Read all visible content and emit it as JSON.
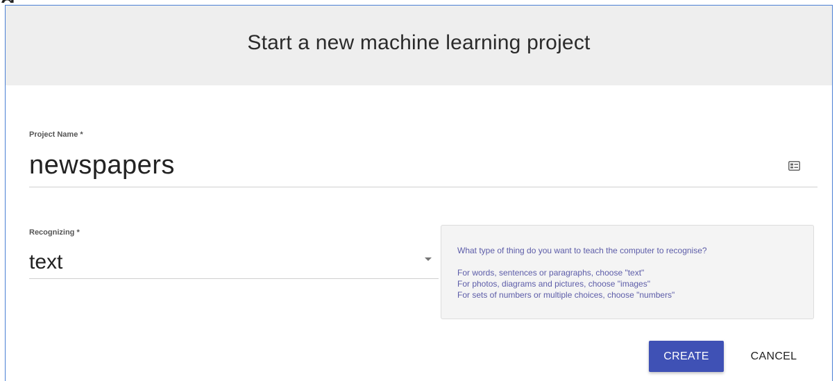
{
  "dialog": {
    "title": "Start a new machine learning project"
  },
  "project_name": {
    "label": "Project Name *",
    "value": "newspapers",
    "icon": "contact-card-icon"
  },
  "recognizing": {
    "label": "Recognizing *",
    "value": "text",
    "icon": "dropdown-arrow-icon"
  },
  "help": {
    "question": "What type of thing do you want to teach the computer to recognise?",
    "lines": [
      "For words, sentences or paragraphs, choose \"text\"",
      "For photos, diagrams and pictures, choose \"images\"",
      "For sets of numbers or multiple choices, choose \"numbers\""
    ]
  },
  "actions": {
    "create_label": "CREATE",
    "cancel_label": "CANCEL"
  },
  "colors": {
    "primary": "#3f51b5",
    "header_bg": "#eeeeee",
    "help_text": "#5c5ca8",
    "dialog_border": "#4a7fd4"
  }
}
